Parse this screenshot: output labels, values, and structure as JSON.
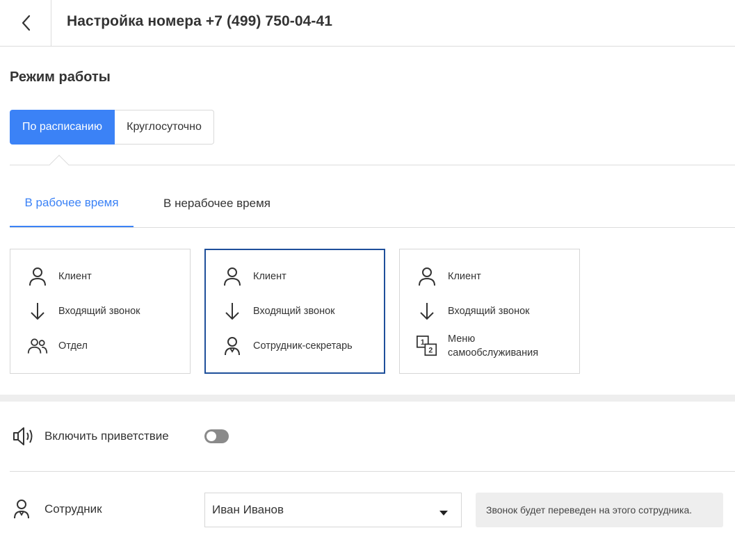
{
  "header": {
    "title": "Настройка номера +7 (499) 750-04-41"
  },
  "work_mode": {
    "title": "Режим работы",
    "options": [
      "По расписанию",
      "Круглосуточно"
    ],
    "selected": "По расписанию"
  },
  "tabs": [
    {
      "label": "В рабочее время",
      "active": true
    },
    {
      "label": "В нерабочее время",
      "active": false
    }
  ],
  "cards": [
    {
      "rows": [
        {
          "icon": "person-icon",
          "label": "Клиент"
        },
        {
          "icon": "arrow-down-icon",
          "label": "Входящий звонок"
        },
        {
          "icon": "group-icon",
          "label": "Отдел"
        }
      ],
      "selected": false
    },
    {
      "rows": [
        {
          "icon": "person-icon",
          "label": "Клиент"
        },
        {
          "icon": "arrow-down-icon",
          "label": "Входящий звонок"
        },
        {
          "icon": "employee-icon",
          "label": "Сотрудник-секретарь"
        }
      ],
      "selected": true
    },
    {
      "rows": [
        {
          "icon": "person-icon",
          "label": "Клиент"
        },
        {
          "icon": "arrow-down-icon",
          "label": "Входящий звонок"
        },
        {
          "icon": "menu-12-icon",
          "label": "Меню самообслуживания"
        }
      ],
      "selected": false
    }
  ],
  "greeting": {
    "label": "Включить приветствие",
    "enabled": false
  },
  "employee": {
    "label": "Сотрудник",
    "value": "Иван Иванов",
    "hint": "Звонок будет переведен на этого сотрудника."
  },
  "colors": {
    "accent": "#3b82f6",
    "selected_border": "#1e4f9a",
    "text": "#333333"
  }
}
